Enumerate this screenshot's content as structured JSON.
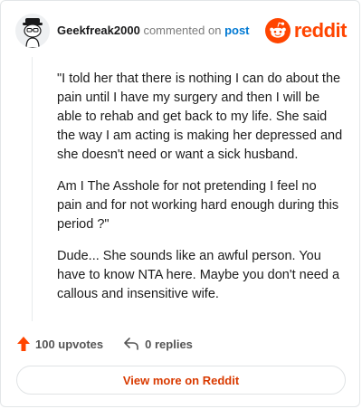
{
  "comment": {
    "username": "Geekfreak2000",
    "action_text": "commented on",
    "post_link_text": "post",
    "brand_name": "reddit",
    "paragraphs": [
      "\"I told her that there is nothing I can do about the pain until I have my surgery and then I will be able to rehab and get back to my life. She said the way I am acting is making her depressed and she doesn't need or want a sick husband.",
      "Am I The Asshole for not pretending I feel no pain and for not working hard enough during this period ?\"",
      "Dude... She sounds like an awful person. You have to know NTA here. Maybe you don't need a callous and insensitive wife."
    ]
  },
  "footer": {
    "upvotes_label": "100 upvotes",
    "replies_label": "0 replies",
    "view_more_label": "View more on Reddit"
  },
  "icons": {
    "avatar": "snoo-avatar-icon",
    "brand": "reddit-logo-icon",
    "upvote": "upvote-arrow-icon",
    "reply": "reply-arrow-icon"
  },
  "colors": {
    "brand": "#ff4500",
    "upvote": "#ff4500",
    "link": "#0079d3",
    "button_text": "#d93a00"
  }
}
